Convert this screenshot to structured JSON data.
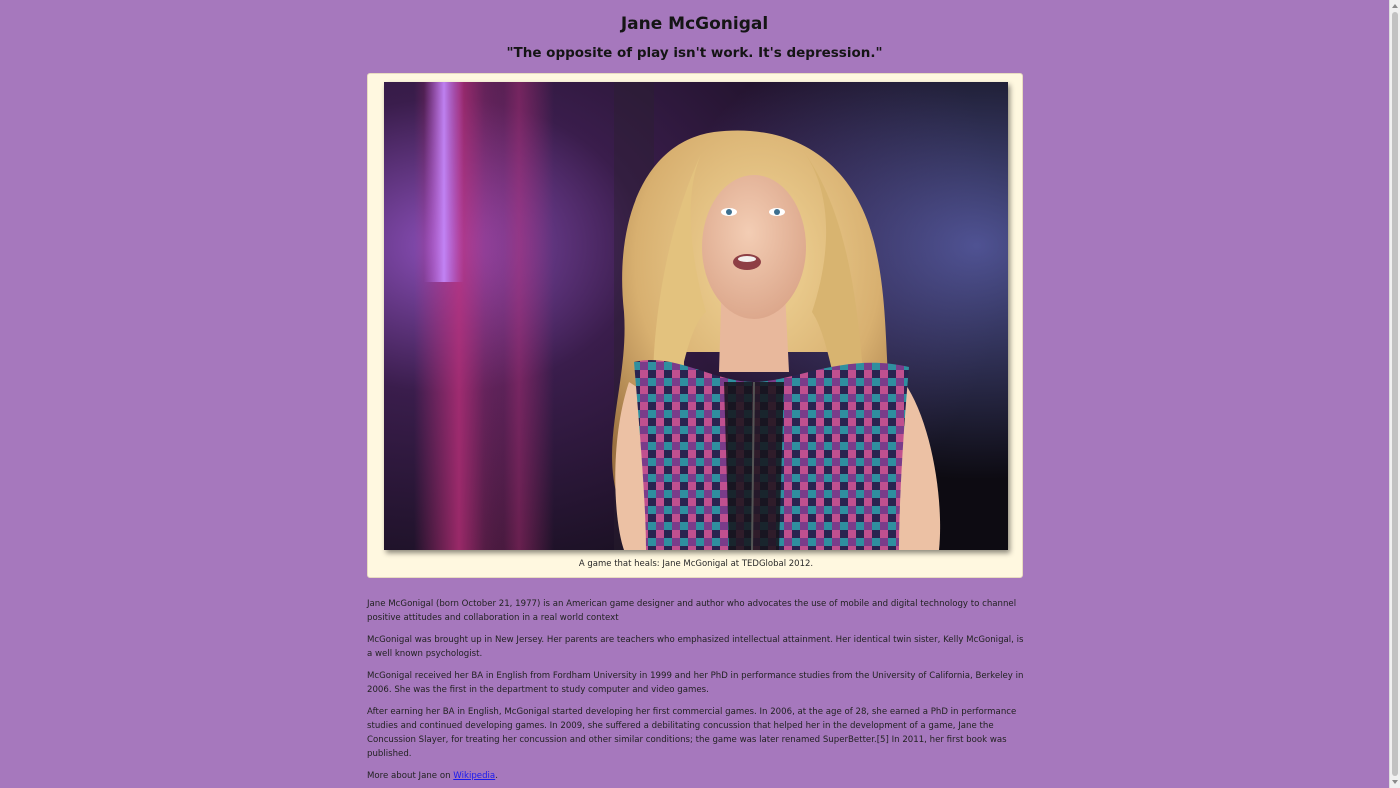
{
  "header": {
    "title": "Jane McGonigal",
    "quote": "\"The opposite of play isn't work. It's depression.\""
  },
  "figure": {
    "caption": "A game that heals: Jane McGonigal at TEDGlobal 2012."
  },
  "content": {
    "paragraphs": [
      "Jane McGonigal (born October 21, 1977) is an American game designer and author who advocates the use of mobile and digital technology to channel positive attitudes and collaboration in a real world context",
      "McGonigal was brought up in New Jersey. Her parents are teachers who emphasized intellectual attainment. Her identical twin sister, Kelly McGonigal, is a well known psychologist.",
      "McGonigal received her BA in English from Fordham University in 1999 and her PhD in performance studies from the University of California, Berkeley in 2006. She was the first in the department to study computer and video games.",
      "After earning her BA in English, McGonigal started developing her first commercial games. In 2006, at the age of 28, she earned a PhD in performance studies and continued developing games. In 2009, she suffered a debilitating concussion that helped her in the development of a game, Jane the Concussion Slayer, for treating her concussion and other similar conditions; the game was later renamed SuperBetter.[5] In 2011, her first book was published."
    ],
    "more_prefix": "More about Jane on ",
    "more_link": "Wikipedia",
    "more_suffix": "."
  },
  "colors": {
    "page_background": "#a678bd",
    "card_background": "#fff8e0",
    "link": "#1a1aee"
  }
}
